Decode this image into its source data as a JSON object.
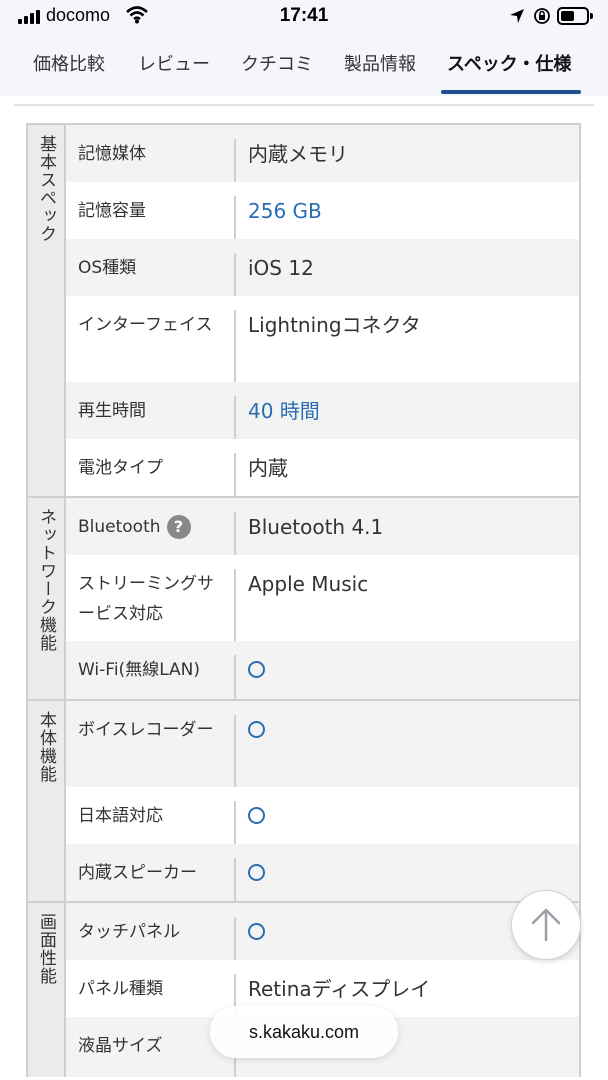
{
  "status_bar": {
    "carrier": "docomo",
    "time": "17:41"
  },
  "tabs": [
    {
      "label": "価格比較"
    },
    {
      "label": "レビュー"
    },
    {
      "label": "クチコミ"
    },
    {
      "label": "製品情報"
    },
    {
      "label": "スペック・仕様",
      "active": true
    }
  ],
  "spec": {
    "groups": [
      {
        "title": "基本スペック",
        "rows": [
          {
            "label": "記憶媒体",
            "value": "内蔵メモリ"
          },
          {
            "label": "記憶容量",
            "value": "256 GB"
          },
          {
            "label": "OS種類",
            "value": "iOS 12"
          },
          {
            "label": "インターフェイス",
            "value": "Lightningコネクタ"
          },
          {
            "label": "再生時間",
            "value": "40 時間"
          },
          {
            "label": "電池タイプ",
            "value": "内蔵"
          }
        ]
      },
      {
        "title": "ネットワーク機能",
        "rows": [
          {
            "label": "Bluetooth",
            "help": "?",
            "value": "Bluetooth 4.1"
          },
          {
            "label": "ストリーミングサービス対応",
            "value": "Apple Music"
          },
          {
            "label": "Wi-Fi(無線LAN)",
            "value": "○"
          }
        ]
      },
      {
        "title": "本体機能",
        "rows": [
          {
            "label": "ボイスレコーダー",
            "value": "○"
          },
          {
            "label": "日本語対応",
            "value": "○"
          },
          {
            "label": "内蔵スピーカー",
            "value": "○"
          }
        ]
      },
      {
        "title": "画面性能",
        "rows": [
          {
            "label": "タッチパネル",
            "value": "○"
          },
          {
            "label": "パネル種類",
            "value": "Retinaディスプレイ"
          },
          {
            "label": "液晶サイズ",
            "value": ""
          }
        ]
      }
    ]
  },
  "url_bar": {
    "domain": "s.kakaku.com"
  },
  "icons": {
    "signal": "cellular-signal-icon",
    "wifi": "wifi-icon",
    "location": "location-arrow-icon",
    "orientation_lock": "orientation-lock-icon",
    "battery": "battery-icon",
    "scroll_top": "arrow-up-icon"
  },
  "colors": {
    "accent": "#1f4f8e",
    "link": "#2a6db3",
    "group_bg": "#ebebeb",
    "row_alt_bg": "#f3f3f3"
  }
}
